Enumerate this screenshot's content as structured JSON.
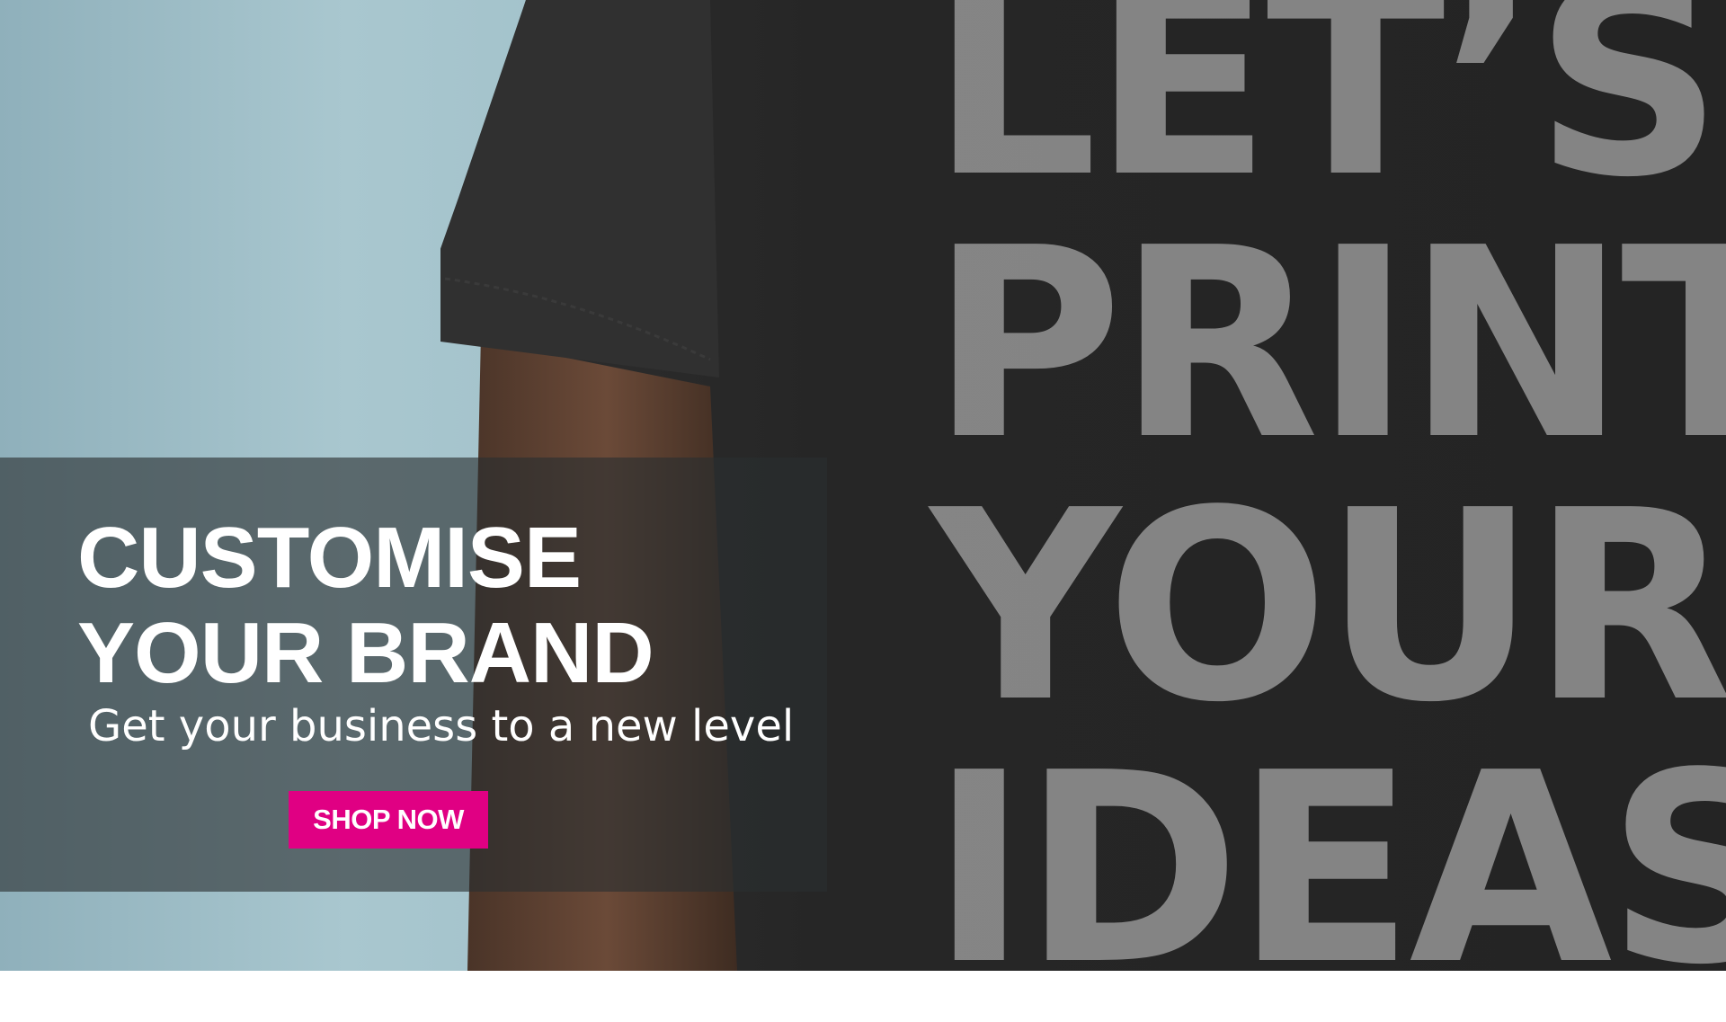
{
  "banner": {
    "headline_line1": "CUSTOMISE",
    "headline_line2": "YOUR BRAND",
    "subline": "Get your business to a new level",
    "cta_label": "SHOP NOW",
    "shirt_print": {
      "line1": "LET’S",
      "line2": "PRINT",
      "line3": "YOUR",
      "line4": "IDEAS"
    }
  },
  "colors": {
    "background": "#a9c7cf",
    "shirt": "#252525",
    "arm": "#5a4030",
    "overlay": "#2a2e30",
    "cta": "#e00083",
    "text": "#ffffff"
  }
}
